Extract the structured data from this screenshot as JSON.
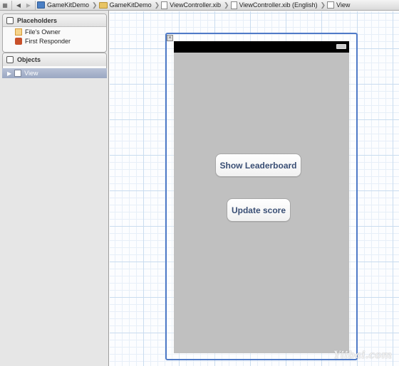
{
  "jumpbar": {
    "crumbs": [
      "GameKitDemo",
      "GameKitDemo",
      "ViewController.xib",
      "ViewController.xib (English)",
      "View"
    ]
  },
  "sidebar": {
    "placeholders": {
      "title": "Placeholders",
      "items": [
        "File's Owner",
        "First Responder"
      ]
    },
    "objects": {
      "title": "Objects",
      "items": [
        "View"
      ]
    }
  },
  "canvas": {
    "buttons": {
      "show_leaderboard": "Show Leaderboard",
      "update_score": "Update score"
    },
    "watermark": "Yiibai.com"
  }
}
